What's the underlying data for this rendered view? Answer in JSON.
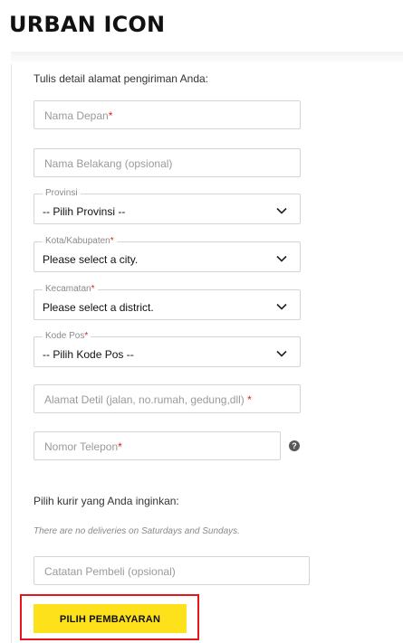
{
  "brand": {
    "logo_text": "URBAN ICON"
  },
  "form": {
    "intro": "Tulis detail alamat pengiriman Anda:",
    "first_name": {
      "placeholder": "Nama Depan",
      "required_mark": "*"
    },
    "last_name": {
      "placeholder": "Nama Belakang (opsional)"
    },
    "province": {
      "legend": "Provinsi",
      "value": "-- Pilih Provinsi --"
    },
    "city": {
      "legend": "Kota/Kabupaten",
      "required_mark": "*",
      "value": "Please select a city."
    },
    "district": {
      "legend": "Kecamatan",
      "required_mark": "*",
      "value": "Please select a district."
    },
    "postal": {
      "legend": "Kode Pos",
      "required_mark": "*",
      "value": "-- Pilih Kode Pos --"
    },
    "address": {
      "placeholder": "Alamat Detil (jalan, no.rumah, gedung,dll)",
      "required_mark": "*"
    },
    "phone": {
      "placeholder": "Nomor Telepon",
      "required_mark": "*"
    },
    "help_icon_glyph": "?",
    "courier_label": "Pilih kurir yang Anda inginkan:",
    "delivery_note": "There are no deliveries on Saturdays and Sundays.",
    "buyer_note": {
      "placeholder": "Catatan Pembeli (opsional)"
    },
    "pay_button_label": "PILIH PEMBAYARAN"
  },
  "colors": {
    "accent_yellow": "#fde11a",
    "required_red": "#e02020",
    "highlight_red": "#e8141c"
  },
  "icons": {
    "dropdown": "chevron-down-icon",
    "help": "question-circle-icon"
  }
}
